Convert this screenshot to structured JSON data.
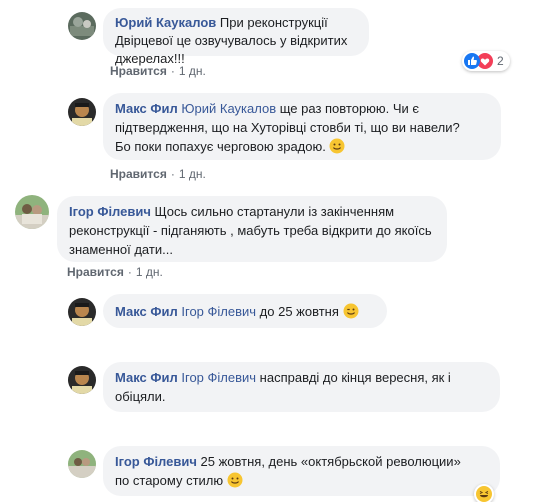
{
  "actions": {
    "like_label": "Нравится",
    "separator": "·"
  },
  "comments": [
    {
      "author": "Юрий Каукалов",
      "text": "При реконструкції Двірцевої це озвучувалось у відкритих джерелах!!!",
      "time": "1 дн.",
      "reaction_count": "2"
    },
    {
      "author": "Макс Фил",
      "mention": "Юрий Каукалов",
      "text_line1": "ще раз повторюю. Чи є",
      "text_line2": "підтвердження, що на Хуторівці стовби ті, що ви навели?",
      "text_line3": "Бо поки попахує черговою зрадою.",
      "time": "1 дн."
    },
    {
      "author": "Ігор Філевич",
      "text_line1": "Щось сильно стартанули із закінченням",
      "text_line2": "реконструкції - підганяють , мабуть треба відкрити до якоїсь",
      "text_line3": "знаменної дати...",
      "time": "1 дн."
    },
    {
      "author": "Макс Фил",
      "mention": "Ігор Філевич",
      "text": "до 25 жовтня"
    },
    {
      "author": "Макс Фил",
      "mention": "Ігор Філевич",
      "text_line1": "насправді до кінця вересня, як і",
      "text_line2": "обіцяли."
    },
    {
      "author": "Ігор Філевич",
      "text_line1": "25 жовтня, день «октябрьской революции»",
      "text_line2": "по старому стилю"
    }
  ],
  "colors": {
    "link": "#385898",
    "bubble": "#f2f3f5",
    "meta": "#606770",
    "like_blue": "#1877f2",
    "love_red": "#f33e58"
  }
}
